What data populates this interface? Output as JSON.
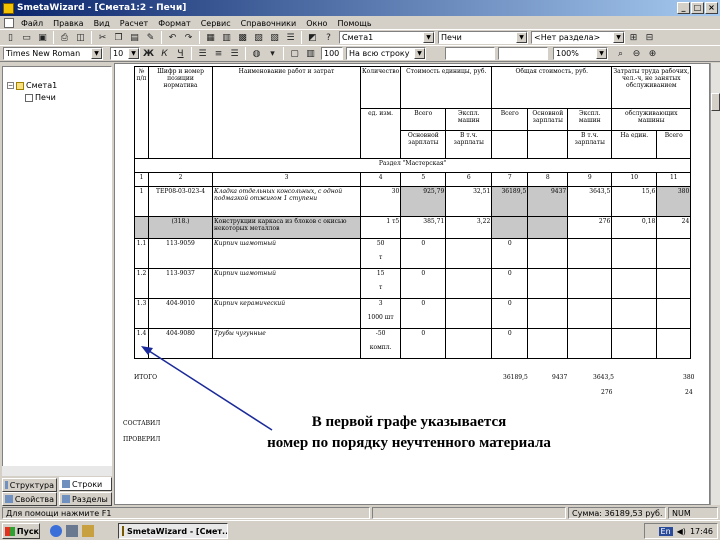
{
  "window": {
    "title": "SmetaWizard - [Смета1:2 - Печи]",
    "buttons": [
      "_",
      "□",
      "×"
    ]
  },
  "menu": [
    "Файл",
    "Правка",
    "Вид",
    "Расчет",
    "Формат",
    "Сервис",
    "Справочники",
    "Окно",
    "Помощь"
  ],
  "toolbar1": {
    "buttons": [
      "new-doc-icon",
      "open-icon",
      "save-icon",
      "print-icon",
      "preview-icon",
      "cut-icon",
      "copy-icon",
      "paste-icon",
      "format-icon",
      "undo-icon",
      "redo-icon"
    ],
    "smeta_combo": "Смета1",
    "section_combo": "Печи",
    "division_combo": "<Нет раздела>"
  },
  "toolbar2": {
    "font_combo": "Times New Roman",
    "size_combo": "10",
    "style_buttons": [
      "Ж",
      "К",
      "Ч"
    ],
    "zoom_value": "100",
    "zoom_label": "На всю строку",
    "zoom_combo": "100%"
  },
  "tree": {
    "root": "Смета1",
    "child": "Печи"
  },
  "panel_tabs": [
    "Структура",
    "Строки",
    "Свойства",
    "Разделы"
  ],
  "table": {
    "headers": {
      "num": "№ п/п",
      "code": "Шифр и номер позиции норматива",
      "name": "Наименование работ и затрат",
      "qty": "Количество",
      "qty_unit": "ед. изм.",
      "unit_cost": "Стоимость единицы, руб.",
      "total_cost": "Общая стоимость, руб.",
      "labor": "Затраты труда рабочих, чел.-ч, не занятых обслуживанием",
      "all": "Всего",
      "machines": "Экспл. машин",
      "all2": "Всего",
      "basic_wage": "Основной зарплаты",
      "machines2": "Экспл. машин",
      "machine_staff": "обслуживающих машины",
      "basic_wage_sub": "Основной зарплаты",
      "incl_wage": "В т.ч. зарплаты",
      "incl_wage2": "В т.ч. зарплаты",
      "per_unit": "На един.",
      "total": "Всего"
    },
    "section": "Раздел \"Мастерская\"",
    "col_numbers": [
      "1",
      "2",
      "3",
      "4",
      "5",
      "6",
      "7",
      "8",
      "9",
      "10",
      "11"
    ],
    "rows": [
      {
        "num": "1",
        "code": "ТЕР08-03-023-4",
        "name": "Кладка отдельных консольных, с одной подмазкой отжигом 1 ступени",
        "qty": "30",
        "c5": "925,79",
        "c6": "32,51",
        "c7": "36189,5",
        "c8": "9437",
        "c9": "3643,5",
        "c10": "15,6",
        "c11": "380"
      },
      {
        "num": "",
        "code": "(318.)",
        "name": "Конструкции каркаса из блоков с окисью некоторых металлов",
        "qty": "1 т5",
        "c5": "385,71",
        "c6": "3,22",
        "c7": "",
        "c8": "",
        "c9": "276",
        "c10": "0,18",
        "c11": "24"
      },
      {
        "num": "1.1",
        "code": "113-9059",
        "name": "Кирпич шамотный",
        "qty": "50",
        "unit": "т",
        "c5": "0",
        "c7": "0"
      },
      {
        "num": "1.2",
        "code": "113-9037",
        "name": "Кирпич шамотный",
        "qty": "15",
        "unit": "т",
        "c5": "0",
        "c7": "0"
      },
      {
        "num": "1.3",
        "code": "404-9010",
        "name": "Кирпич керамический",
        "qty": "3",
        "unit": "1000 шт",
        "c5": "0",
        "c7": "0"
      },
      {
        "num": "1.4",
        "code": "404-9080",
        "name": "Трубы чугунные",
        "qty": "-50",
        "unit": "компл.",
        "c5": "0",
        "c7": "0"
      }
    ],
    "totals": {
      "label": "ИТОГО",
      "c7": "36189,5",
      "c8": "9437",
      "c9": "3643,5",
      "c11": "380",
      "c9b": "276",
      "c11b": "24"
    },
    "signatures": {
      "made": "СОСТАВИЛ",
      "checked": "ПРОВЕРИЛ"
    }
  },
  "annotation": {
    "line1": "В первой графе указывается",
    "line2": "номер по порядку неучтенного материала",
    "color": "#1a2a9a"
  },
  "status": {
    "help": "Для помощи нажмите F1",
    "sum": "Сумма: 36189,53 руб.",
    "mode": "NUM"
  },
  "taskbar": {
    "start": "Пуск",
    "task": "SmetaWizard - [Смет...",
    "clock": "17:46",
    "lang": "En"
  }
}
